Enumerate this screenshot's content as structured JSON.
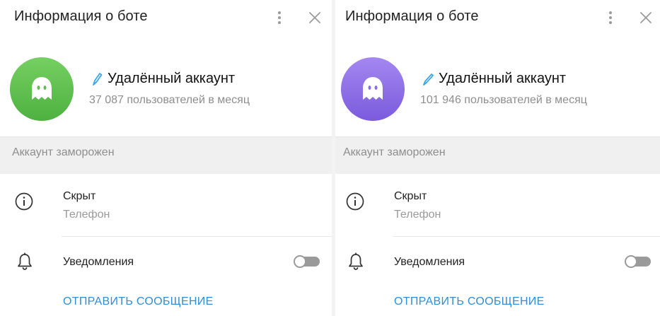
{
  "panels": [
    {
      "title": "Информация о боте",
      "name": "Удалённый аккаунт",
      "subtitle": "37 087 пользователей в месяц",
      "avatar_color": "#5fbe4f",
      "frozen_notice": "Аккаунт заморожен",
      "phone_value": "Скрыт",
      "phone_label": "Телефон",
      "notifications_label": "Уведомления",
      "notifications_enabled": false,
      "send_message_label": "ОТПРАВИТЬ СООБЩЕНИЕ"
    },
    {
      "title": "Информация о боте",
      "name": "Удалённый аккаунт",
      "subtitle": "101 946 пользователей в месяц",
      "avatar_color": "#8c6fe8",
      "frozen_notice": "Аккаунт заморожен",
      "phone_value": "Скрыт",
      "phone_label": "Телефон",
      "notifications_label": "Уведомления",
      "notifications_enabled": false,
      "send_message_label": "ОТПРАВИТЬ СООБЩЕНИЕ"
    }
  ],
  "colors": {
    "accent": "#2f8ed6",
    "secondary_text": "#8e8e8e",
    "frozen_bg": "#f0f0f0"
  },
  "icons": [
    "more-vertical-icon",
    "close-icon",
    "ghost-icon",
    "pen-icon",
    "info-icon",
    "bell-icon"
  ]
}
